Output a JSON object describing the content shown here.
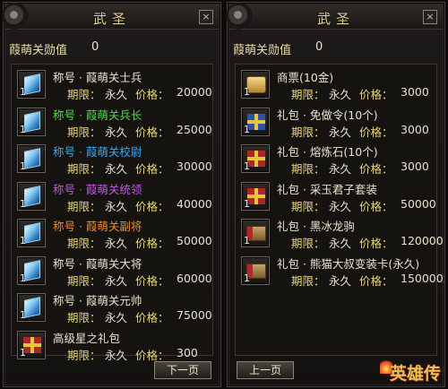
{
  "left": {
    "title": "武圣",
    "close": "×",
    "merit_label": "葭萌关勋值",
    "merit_value": "0",
    "next_label": "下一页",
    "items": [
      {
        "name": "称号 · 葭萌关士兵",
        "color": "#ebe3cf",
        "icon": "crystal-icon",
        "count": "1",
        "period_label": "期限：",
        "period": "永久",
        "price_label": "价格：",
        "price": "20000"
      },
      {
        "name": "称号 · 葭萌关兵长",
        "color": "#4fdc4a",
        "icon": "crystal-icon",
        "count": "1",
        "period_label": "期限：",
        "period": "永久",
        "price_label": "价格：",
        "price": "25000"
      },
      {
        "name": "称号 · 葭萌关校尉",
        "color": "#3fa8ee",
        "icon": "crystal-icon",
        "count": "1",
        "period_label": "期限：",
        "period": "永久",
        "price_label": "价格：",
        "price": "30000"
      },
      {
        "name": "称号 · 葭萌关统领",
        "color": "#c257e6",
        "icon": "crystal-icon",
        "count": "1",
        "period_label": "期限：",
        "period": "永久",
        "price_label": "价格：",
        "price": "40000"
      },
      {
        "name": "称号 · 葭萌关副将",
        "color": "#f08a2c",
        "icon": "crystal-icon",
        "count": "1",
        "period_label": "期限：",
        "period": "永久",
        "price_label": "价格：",
        "price": "50000"
      },
      {
        "name": "称号 · 葭萌关大将",
        "color": "#ebe3cf",
        "icon": "crystal-icon",
        "count": "1",
        "period_label": "期限：",
        "period": "永久",
        "price_label": "价格：",
        "price": "60000"
      },
      {
        "name": "称号 · 葭萌关元帅",
        "color": "#ebe3cf",
        "icon": "crystal-icon",
        "count": "1",
        "period_label": "期限：",
        "period": "永久",
        "price_label": "价格：",
        "price": "75000"
      },
      {
        "name": "高级星之礼包",
        "color": "#ebe3cf",
        "icon": "gift-icon",
        "count": "1",
        "period_label": "期限：",
        "period": "永久",
        "price_label": "价格：",
        "price": "300"
      }
    ]
  },
  "right": {
    "title": "武圣",
    "close": "×",
    "merit_label": "葭萌关勋值",
    "merit_value": "0",
    "prev_label": "上一页",
    "items": [
      {
        "name": "商票(10金)",
        "color": "#ebe3cf",
        "icon": "ticket-icon",
        "count": "1",
        "period_label": "期限：",
        "period": "永久",
        "price_label": "价格：",
        "price": "3000"
      },
      {
        "name": "礼包 · 免做令(10个)",
        "color": "#ebe3cf",
        "icon": "gift-icon",
        "count": "1",
        "period_label": "期限：",
        "period": "永久",
        "price_label": "价格：",
        "price": "3000"
      },
      {
        "name": "礼包 · 熔炼石(10个)",
        "color": "#ebe3cf",
        "icon": "gift-icon",
        "count": "1",
        "period_label": "期限：",
        "period": "永久",
        "price_label": "价格：",
        "price": "3000"
      },
      {
        "name": "礼包 · 采玉君子套装",
        "color": "#ebe3cf",
        "icon": "gift-icon",
        "count": "1",
        "period_label": "期限：",
        "period": "永久",
        "price_label": "价格：",
        "price": "50000"
      },
      {
        "name": "礼包 · 黑冰龙驹",
        "color": "#ebe3cf",
        "icon": "crate-icon",
        "count": "1",
        "period_label": "期限：",
        "period": "永久",
        "price_label": "价格：",
        "price": "120000"
      },
      {
        "name": "礼包 · 熊猫大叔变装卡(永久)",
        "color": "#ebe3cf",
        "icon": "crate-icon",
        "count": "1",
        "period_label": "期限：",
        "period": "永久",
        "price_label": "价格：",
        "price": "150000"
      }
    ]
  },
  "logo": "英雄传"
}
